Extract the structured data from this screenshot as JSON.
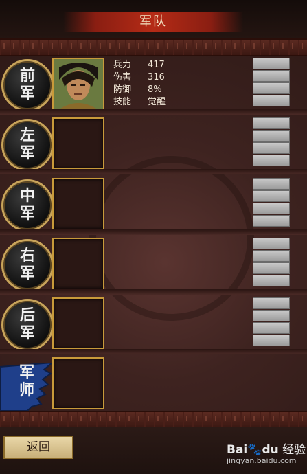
{
  "header": {
    "title": "军队"
  },
  "slots": [
    {
      "medal_top": "前",
      "medal_bottom": "军",
      "has_general": true,
      "stats": [
        {
          "label": "兵力",
          "value": "417"
        },
        {
          "label": "伤害",
          "value": "316"
        },
        {
          "label": "防御",
          "value": "8%"
        },
        {
          "label": "技能",
          "value": "觉醒"
        }
      ]
    },
    {
      "medal_top": "左",
      "medal_bottom": "军",
      "has_general": false
    },
    {
      "medal_top": "中",
      "medal_bottom": "军",
      "has_general": false
    },
    {
      "medal_top": "右",
      "medal_bottom": "军",
      "has_general": false
    },
    {
      "medal_top": "后",
      "medal_bottom": "军",
      "has_general": false
    },
    {
      "medal_top": "军",
      "medal_bottom": "师",
      "has_general": false,
      "style": "banner"
    }
  ],
  "footer": {
    "back_label": "返回"
  },
  "watermark": {
    "brand_a": "Bai",
    "brand_b": "du",
    "brand_c": "经验",
    "url": "jingyan.baidu.com"
  },
  "colors": {
    "title_ribbon": "#b52b16",
    "gold_frame": "#c89a3a",
    "button_gray": "#b0b0b0",
    "banner_blue": "#1f3f8a"
  }
}
